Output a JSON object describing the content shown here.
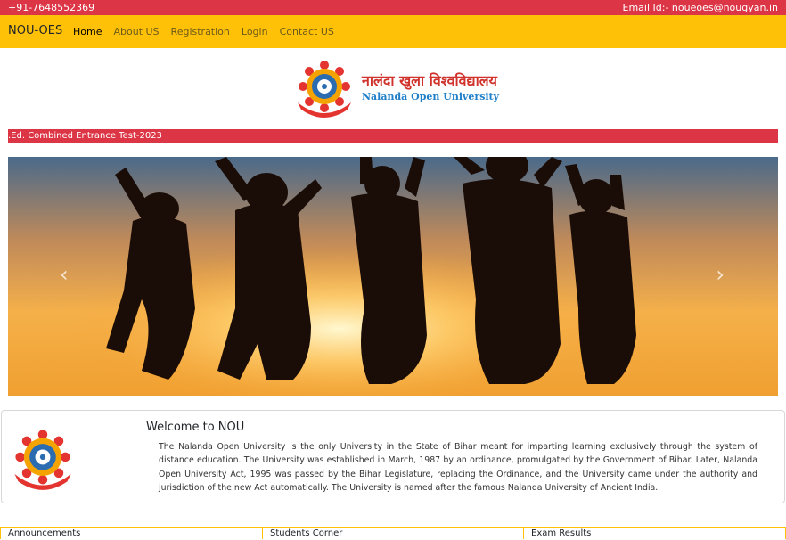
{
  "topbar": {
    "phone": "+91-7648552369",
    "email": "Email Id:- noueoes@nougyan.in"
  },
  "navbar": {
    "brand": "NOU-OES",
    "links": [
      "Home",
      "About US",
      "Registration",
      "Login",
      "Contact US"
    ],
    "active": "Home"
  },
  "logo": {
    "hindi": "नालंदा खुला विश्वविद्यालय",
    "english": "Nalanda Open University"
  },
  "marquee": {
    "text": ".Ed. Combined Entrance Test-2023"
  },
  "carousel": {
    "prev_icon": "‹",
    "next_icon": "›"
  },
  "welcome": {
    "title": "Welcome to NOU",
    "text": "The Nalanda Open University is the only University in the State of Bihar meant for imparting learning exclusively through the system of distance education. The University was established in March, 1987 by an ordinance, promulgated by the Government of Bihar. Later, Nalanda Open University Act, 1995 was passed by the Bihar Legislature, replacing the Ordinance, and the University came under the authority and jurisdiction of the new Act automatically. The University is named after the famous Nalanda University of Ancient India."
  },
  "cards": [
    "Announcements",
    "Students Corner",
    "Exam Results"
  ],
  "colors": {
    "topbar": "#dc3545",
    "navbar": "#ffc107",
    "hindi_text": "#d0322c",
    "english_text": "#1f7fc9"
  }
}
